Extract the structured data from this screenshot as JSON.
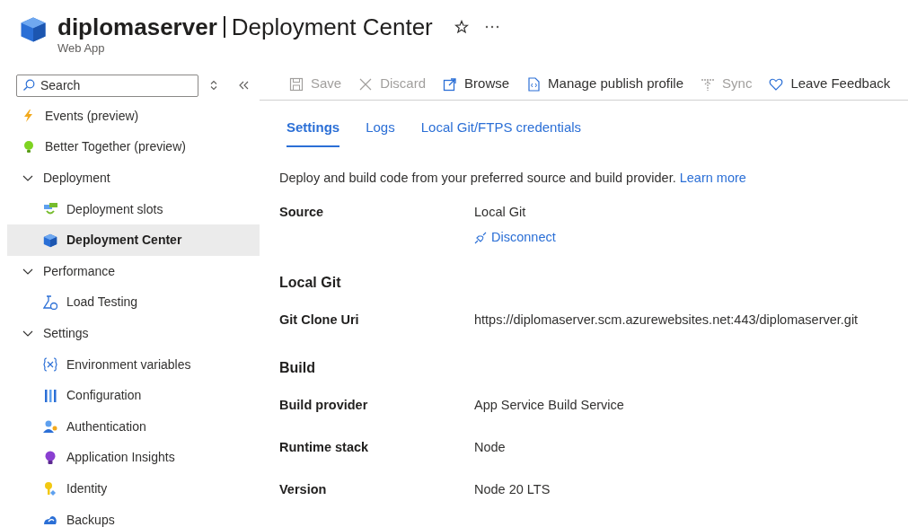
{
  "header": {
    "resource": "diplomaserver",
    "page": "Deployment Center",
    "subtitle": "Web App"
  },
  "sidebar": {
    "search": {
      "placeholder": "Search"
    },
    "items": [
      {
        "kind": "item",
        "label": "Events (preview)",
        "selected": false
      },
      {
        "kind": "item",
        "label": "Better Together (preview)",
        "selected": false
      },
      {
        "kind": "group",
        "label": "Deployment",
        "expanded": true,
        "children": [
          {
            "kind": "item",
            "label": "Deployment slots",
            "selected": false
          },
          {
            "kind": "item",
            "label": "Deployment Center",
            "selected": true
          }
        ]
      },
      {
        "kind": "group",
        "label": "Performance",
        "expanded": true,
        "children": [
          {
            "kind": "item",
            "label": "Load Testing",
            "selected": false
          }
        ]
      },
      {
        "kind": "group",
        "label": "Settings",
        "expanded": true,
        "children": [
          {
            "kind": "item",
            "label": "Environment variables",
            "selected": false
          },
          {
            "kind": "item",
            "label": "Configuration",
            "selected": false
          },
          {
            "kind": "item",
            "label": "Authentication",
            "selected": false
          },
          {
            "kind": "item",
            "label": "Application Insights",
            "selected": false
          },
          {
            "kind": "item",
            "label": "Identity",
            "selected": false
          },
          {
            "kind": "item",
            "label": "Backups",
            "selected": false
          }
        ]
      }
    ]
  },
  "toolbar": [
    {
      "label": "Save",
      "disabled": true
    },
    {
      "label": "Discard",
      "disabled": true
    },
    {
      "label": "Browse",
      "disabled": false
    },
    {
      "label": "Manage publish profile",
      "disabled": false
    },
    {
      "label": "Sync",
      "disabled": true
    },
    {
      "label": "Leave Feedback",
      "disabled": false
    }
  ],
  "tabs": [
    {
      "label": "Settings",
      "selected": true
    },
    {
      "label": "Logs",
      "selected": false
    },
    {
      "label": "Local Git/FTPS credentials",
      "selected": false
    }
  ],
  "description": {
    "text": "Deploy and build code from your preferred source and build provider.",
    "link": "Learn more"
  },
  "sections": [
    {
      "kind": "rows",
      "rows": [
        {
          "label": "Source",
          "value": "Local Git",
          "action": "Disconnect"
        }
      ]
    },
    {
      "kind": "heading",
      "title": "Local Git"
    },
    {
      "kind": "rows",
      "rows": [
        {
          "label": "Git Clone Uri",
          "value": "https://diplomaserver.scm.azurewebsites.net:443/diplomaserver.git"
        }
      ]
    },
    {
      "kind": "heading",
      "title": "Build"
    },
    {
      "kind": "rows",
      "rows": [
        {
          "label": "Build provider",
          "value": "App Service Build Service"
        },
        {
          "label": "Runtime stack",
          "value": "Node"
        },
        {
          "label": "Version",
          "value": "Node 20 LTS"
        }
      ]
    }
  ]
}
